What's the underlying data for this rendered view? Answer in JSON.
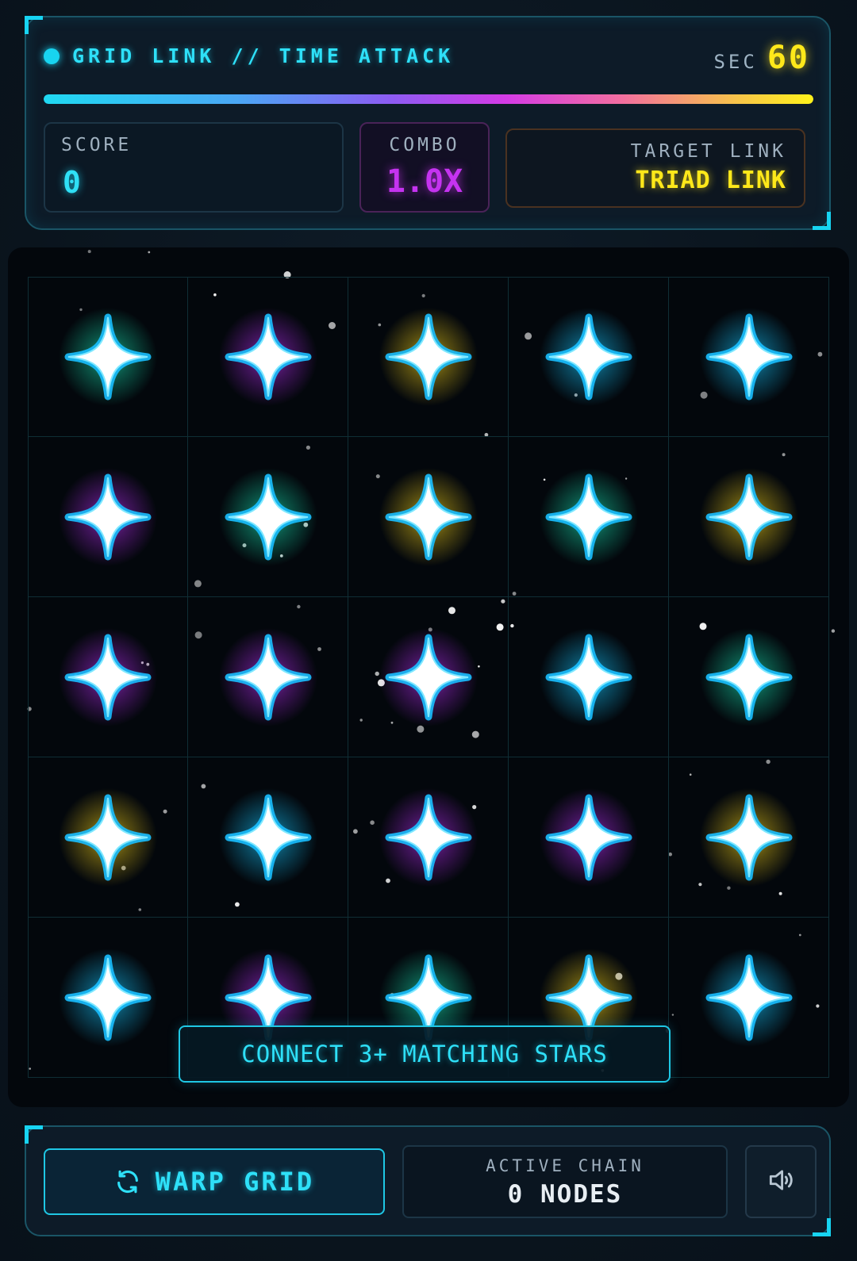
{
  "hud": {
    "title": "GRID LINK // TIME ATTACK",
    "timer_label": "SEC",
    "timer_value": "60",
    "time_remaining_fraction": 1.0,
    "score_label": "SCORE",
    "score_value": "0",
    "combo_label": "COMBO",
    "combo_value": "1.0X",
    "target_label": "TARGET LINK",
    "target_value": "TRIAD LINK"
  },
  "board": {
    "rows": 5,
    "cols": 5,
    "cells": [
      [
        "teal",
        "purple",
        "yellow",
        "cyan",
        "cyan"
      ],
      [
        "purple",
        "teal",
        "yellow",
        "teal",
        "yellow"
      ],
      [
        "purple",
        "purple",
        "purple",
        "cyan",
        "teal"
      ],
      [
        "yellow",
        "cyan",
        "purple",
        "purple",
        "yellow"
      ],
      [
        "cyan",
        "purple",
        "teal",
        "yellow",
        "cyan"
      ]
    ],
    "glow_colors": {
      "cyan": "#17c8ff",
      "teal": "#18e0b0",
      "purple": "#b52cf0",
      "yellow": "#f5d21a"
    },
    "hint": "CONNECT 3+ MATCHING STARS"
  },
  "controls": {
    "warp_label": "WARP GRID",
    "warp_icon": "refresh-icon",
    "chain_label": "ACTIVE CHAIN",
    "chain_value": "0 NODES",
    "sound_icon": "speaker-icon"
  }
}
